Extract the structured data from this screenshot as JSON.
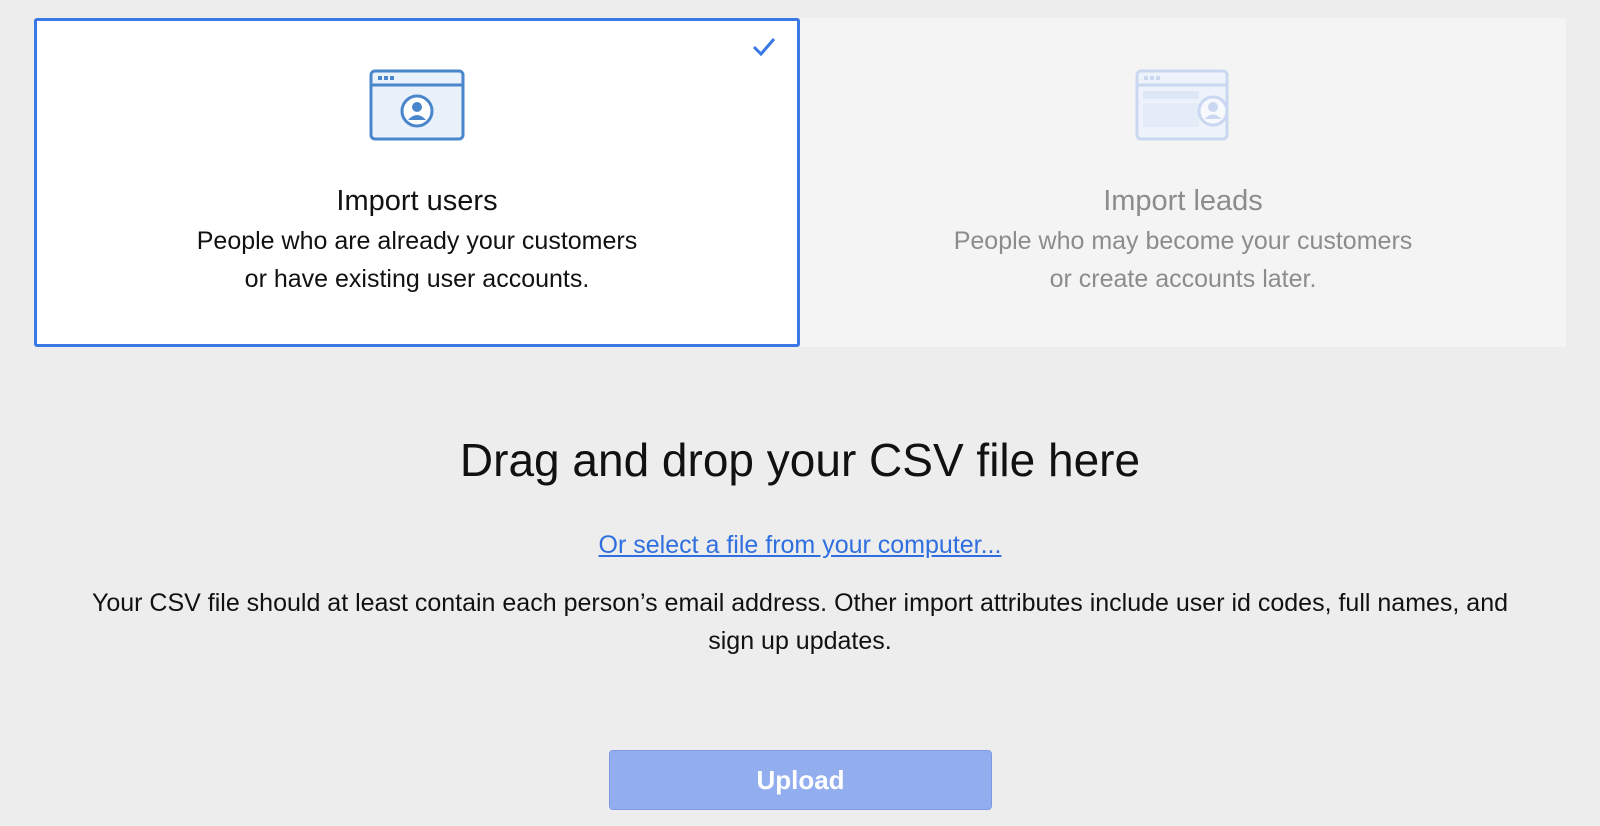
{
  "import_options": [
    {
      "id": "users",
      "title": "Import users",
      "description_lines": [
        "People who are already your customers",
        "or have existing user accounts."
      ],
      "selected": true,
      "icon": "browser-user-icon"
    },
    {
      "id": "leads",
      "title": "Import leads",
      "description_lines": [
        "People who may become your customers",
        "or create accounts later."
      ],
      "selected": false,
      "icon": "browser-lead-icon"
    }
  ],
  "dropzone": {
    "title": "Drag and drop your CSV file here",
    "select_link": "Or select a file from your computer...",
    "hint": "Your CSV file should at least contain each person’s email address. Other import attributes include user id codes, full names, and sign up updates."
  },
  "upload_button": {
    "label": "Upload",
    "enabled": false
  },
  "colors": {
    "accent": "#3a78e8",
    "link": "#2f6fe0",
    "button_disabled": "#93aeee"
  }
}
